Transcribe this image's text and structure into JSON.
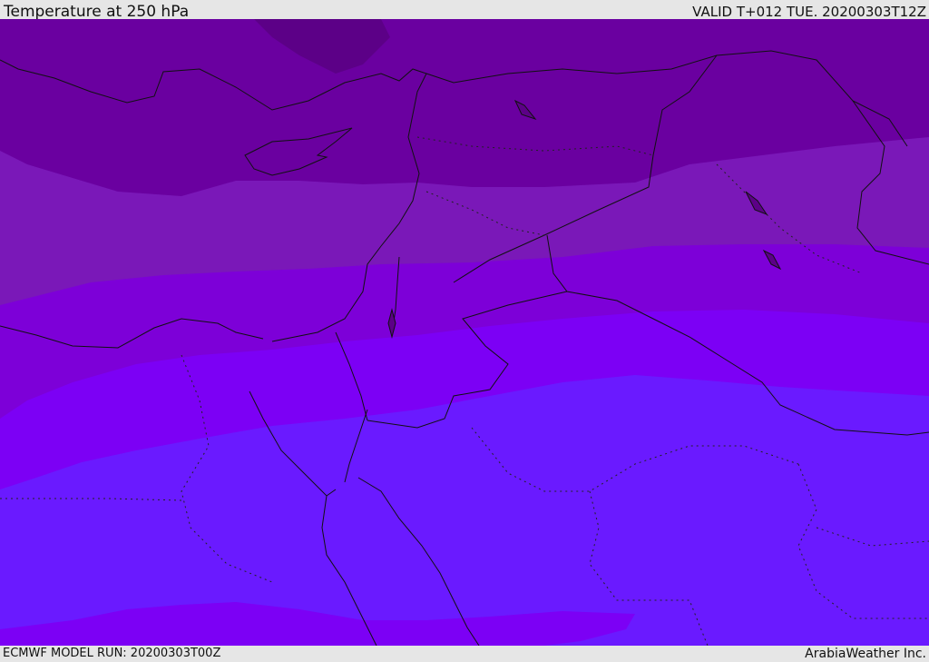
{
  "header": {
    "title": "Temperature at 250 hPa",
    "valid_time": "VALID T+012 TUE. 20200303T12Z"
  },
  "footer": {
    "model_run": "ECMWF MODEL RUN: 20200303T00Z",
    "credit": "ArabiaWeather Inc."
  },
  "map": {
    "variable": "temperature",
    "level": "250 hPa",
    "region": "Eastern Mediterranean / Middle East",
    "band_colors": [
      "#5c0087",
      "#6a00a0",
      "#7a18b8",
      "#7d00d8",
      "#7c00f5",
      "#6a1aff",
      "#7c00f5"
    ],
    "coastline_color": "#111111",
    "border_style": "solid",
    "admin_border_style": "dotted"
  }
}
